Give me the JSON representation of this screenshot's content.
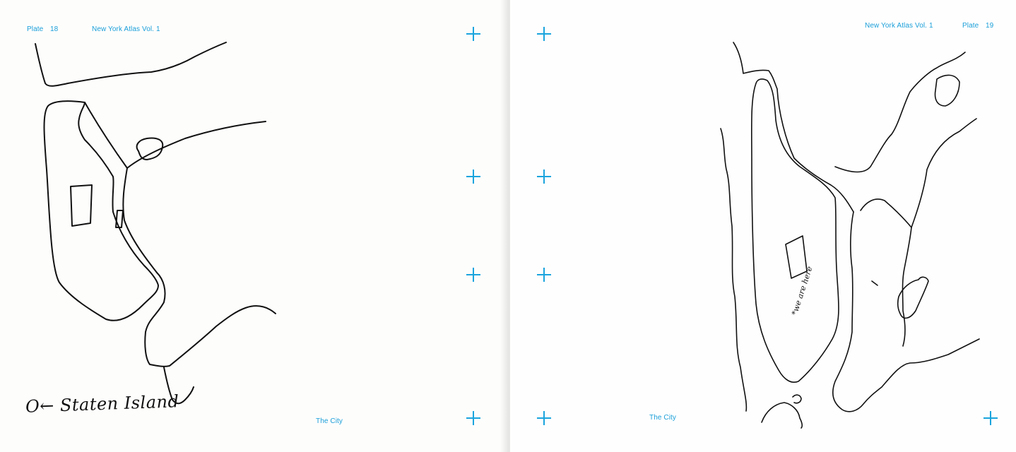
{
  "left_page": {
    "plate_label": "Plate",
    "plate_number": "18",
    "atlas_title": "New York Atlas Vol. 1",
    "footer": "The City",
    "handwritten_label": "O← Staten Island"
  },
  "right_page": {
    "plate_label": "Plate",
    "plate_number": "19",
    "atlas_title": "New York Atlas Vol. 1",
    "footer": "The City",
    "handwritten_note": "*we are here"
  },
  "accent_color": "#1aa4dd",
  "icons": {
    "registration_mark": "crosshair-plus-icon"
  }
}
